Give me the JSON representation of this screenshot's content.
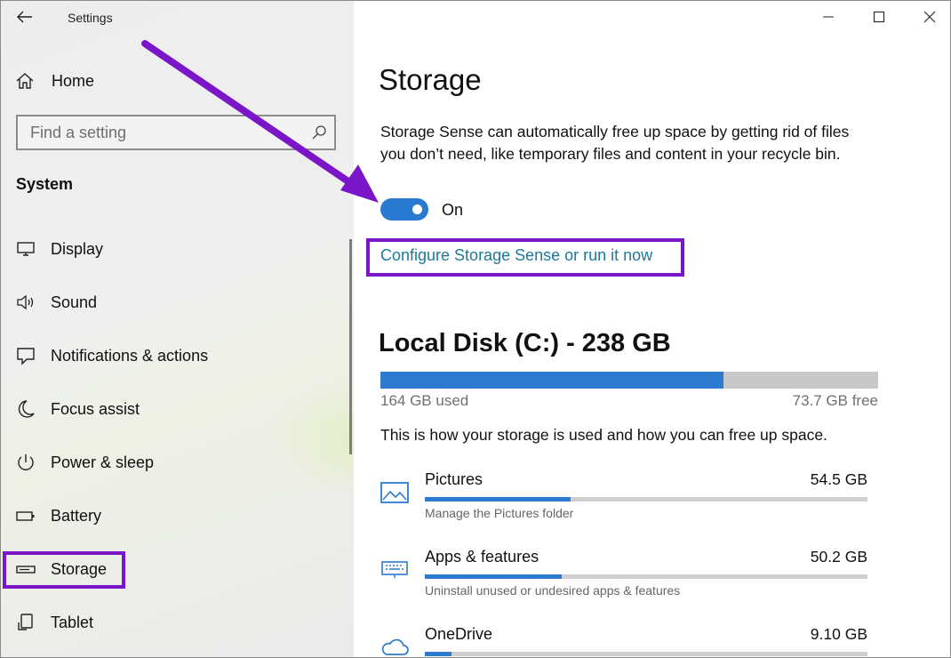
{
  "window": {
    "title": "Settings"
  },
  "sidebar": {
    "home_label": "Home",
    "search_placeholder": "Find a setting",
    "section_title": "System",
    "items": [
      {
        "label": "Display",
        "icon": "monitor-icon"
      },
      {
        "label": "Sound",
        "icon": "speaker-icon"
      },
      {
        "label": "Notifications & actions",
        "icon": "notification-icon"
      },
      {
        "label": "Focus assist",
        "icon": "moon-icon"
      },
      {
        "label": "Power & sleep",
        "icon": "power-icon"
      },
      {
        "label": "Battery",
        "icon": "battery-icon"
      },
      {
        "label": "Storage",
        "icon": "storage-drive-icon",
        "selected": true
      },
      {
        "label": "Tablet",
        "icon": "tablet-icon"
      }
    ]
  },
  "main": {
    "title": "Storage",
    "description": "Storage Sense can automatically free up space by getting rid of files you don’t need, like temporary files and content in your recycle bin.",
    "toggle": {
      "state_label": "On",
      "on": true
    },
    "configure_link": "Configure Storage Sense or run it now",
    "disk": {
      "title": "Local Disk (C:) - 238 GB",
      "used_label": "164 GB used",
      "free_label": "73.7 GB free",
      "used_fraction": 0.69
    },
    "usage_intro": "This is how your storage is used and how you can free up space.",
    "categories": [
      {
        "name": "Pictures",
        "size": "54.5 GB",
        "subtitle": "Manage the Pictures folder",
        "fraction": 0.33,
        "icon": "picture-icon"
      },
      {
        "name": "Apps & features",
        "size": "50.2 GB",
        "subtitle": "Uninstall unused or undesired apps & features",
        "fraction": 0.31,
        "icon": "keyboard-icon"
      },
      {
        "name": "OneDrive",
        "size": "9.10 GB",
        "subtitle": "",
        "fraction": 0.06,
        "icon": "cloud-icon"
      }
    ]
  },
  "colors": {
    "accent": "#2d7bd0",
    "link": "#1d7a9a",
    "highlight": "#7b16c8"
  }
}
